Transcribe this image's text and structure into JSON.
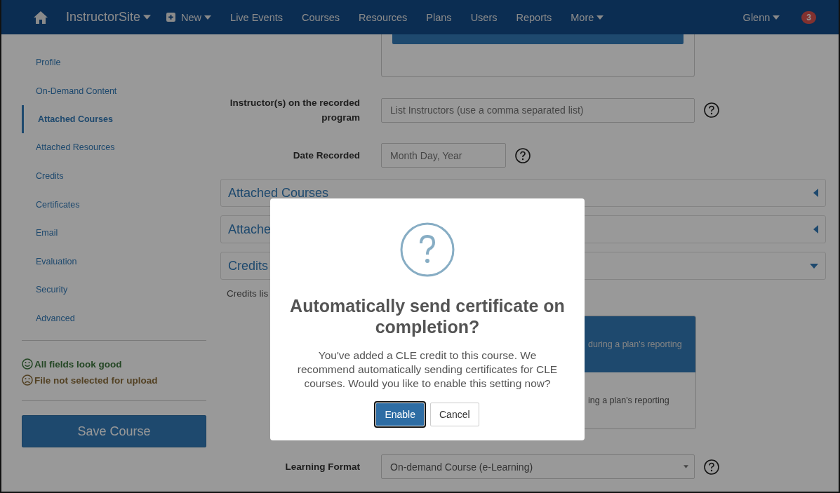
{
  "nav": {
    "brand": "InstructorSite",
    "items": [
      {
        "label": "New",
        "kind": "new",
        "caret": true
      },
      {
        "label": "Live Events",
        "kind": "link",
        "caret": false
      },
      {
        "label": "Courses",
        "kind": "link",
        "caret": false
      },
      {
        "label": "Resources",
        "kind": "link",
        "caret": false
      },
      {
        "label": "Plans",
        "kind": "link",
        "caret": false
      },
      {
        "label": "Users",
        "kind": "link",
        "caret": false
      },
      {
        "label": "Reports",
        "kind": "link",
        "caret": false
      },
      {
        "label": "More",
        "kind": "link",
        "caret": true
      }
    ],
    "user": "Glenn",
    "badge": "3"
  },
  "sidebar": {
    "items": [
      {
        "label": "Profile",
        "selected": false
      },
      {
        "label": "On-Demand Content",
        "selected": false
      },
      {
        "label": "Attached Courses",
        "selected": true
      },
      {
        "label": "Attached Resources",
        "selected": false
      },
      {
        "label": "Credits",
        "selected": false
      },
      {
        "label": "Certificates",
        "selected": false
      },
      {
        "label": "Email",
        "selected": false
      },
      {
        "label": "Evaluation",
        "selected": false
      },
      {
        "label": "Security",
        "selected": false
      },
      {
        "label": "Advanced",
        "selected": false
      }
    ],
    "status": [
      {
        "kind": "ok",
        "text": "All fields look good"
      },
      {
        "kind": "warn",
        "text": "File not selected for upload"
      }
    ],
    "save_button": "Save Course"
  },
  "form": {
    "fields": [
      {
        "label": "Instructor(s) on the recorded program",
        "placeholder": "List Instructors (use a comma separated list)"
      },
      {
        "label": "Date Recorded",
        "placeholder": "Month Day, Year"
      }
    ],
    "sections": [
      {
        "title": "Attached Courses",
        "expanded": false
      },
      {
        "title": "Attache",
        "expanded": false
      },
      {
        "title": "Credits",
        "expanded": true
      }
    ],
    "credits_note": "Credits lis",
    "cards": [
      {
        "kind": "highlight",
        "text": "during a plan's reporting"
      },
      {
        "kind": "plain",
        "text": "ing a plan's reporting"
      }
    ],
    "learning_format": {
      "label": "Learning Format",
      "value": "On-demand Course (e-Learning)"
    }
  },
  "modal": {
    "title": "Automatically send certificate on completion?",
    "message": "You've added a CLE credit to this course. We recommend automatically sending certificates for CLE courses. Would you like to enable this setting now?",
    "buttons": [
      {
        "label": "Enable",
        "kind": "primary"
      },
      {
        "label": "Cancel",
        "kind": "default"
      }
    ]
  }
}
